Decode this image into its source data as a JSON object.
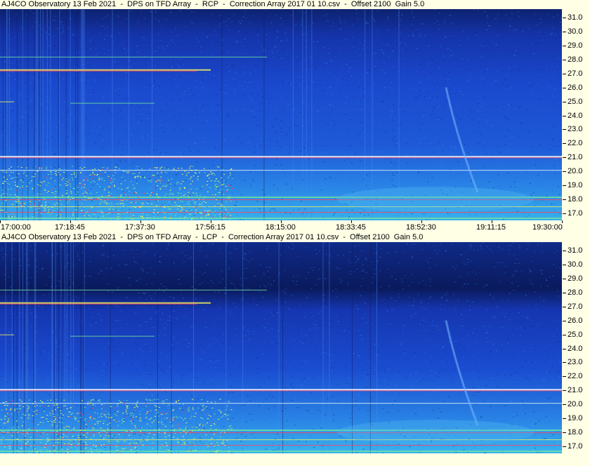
{
  "chart_data": [
    {
      "type": "heatmap",
      "title": "AJ4CO Observatory 13 Feb 2021  -  DPS on TFD Array  -  RCP  -  Correction Array 2017 01 10.csv  -  Offset 2100  Gain 5.0",
      "xlabel": "",
      "ylabel": "",
      "x_ticks": [
        "17:00:00",
        "17:18:45",
        "17:37:30",
        "17:56:15",
        "18:15:00",
        "18:33:45",
        "18:52:30",
        "19:11:15",
        "19:30:00"
      ],
      "y_ticks": [
        "31.0",
        "30.0",
        "29.0",
        "28.0",
        "27.0",
        "26.0",
        "25.0",
        "24.0",
        "23.0",
        "22.0",
        "21.0",
        "20.0",
        "19.0",
        "18.0",
        "17.0"
      ],
      "ylim": [
        16.5,
        31.6
      ],
      "xlim": [
        "17:00:00",
        "19:30:00"
      ],
      "colormap": [
        "#0a1a5c",
        "#1f4fd8",
        "#2aa0e8",
        "#6fe0a0",
        "#f0f060",
        "#ff4060"
      ]
    },
    {
      "type": "heatmap",
      "title": "AJ4CO Observatory 13 Feb 2021  -  DPS on TFD Array  -  LCP  -  Correction Array 2017 01 10.csv  -  Offset 2100  Gain 5.0",
      "xlabel": "",
      "ylabel": "",
      "x_ticks": [],
      "y_ticks": [
        "31.0",
        "30.0",
        "29.0",
        "28.0",
        "27.0",
        "26.0",
        "25.0",
        "24.0",
        "23.0",
        "22.0",
        "21.0",
        "20.0",
        "19.0",
        "18.0",
        "17.0"
      ],
      "ylim": [
        16.5,
        31.6
      ],
      "xlim": [
        "17:00:00",
        "19:30:00"
      ],
      "colormap": [
        "#0a1a5c",
        "#1f4fd8",
        "#2aa0e8",
        "#6fe0a0",
        "#f0f060",
        "#ff4060"
      ]
    }
  ]
}
